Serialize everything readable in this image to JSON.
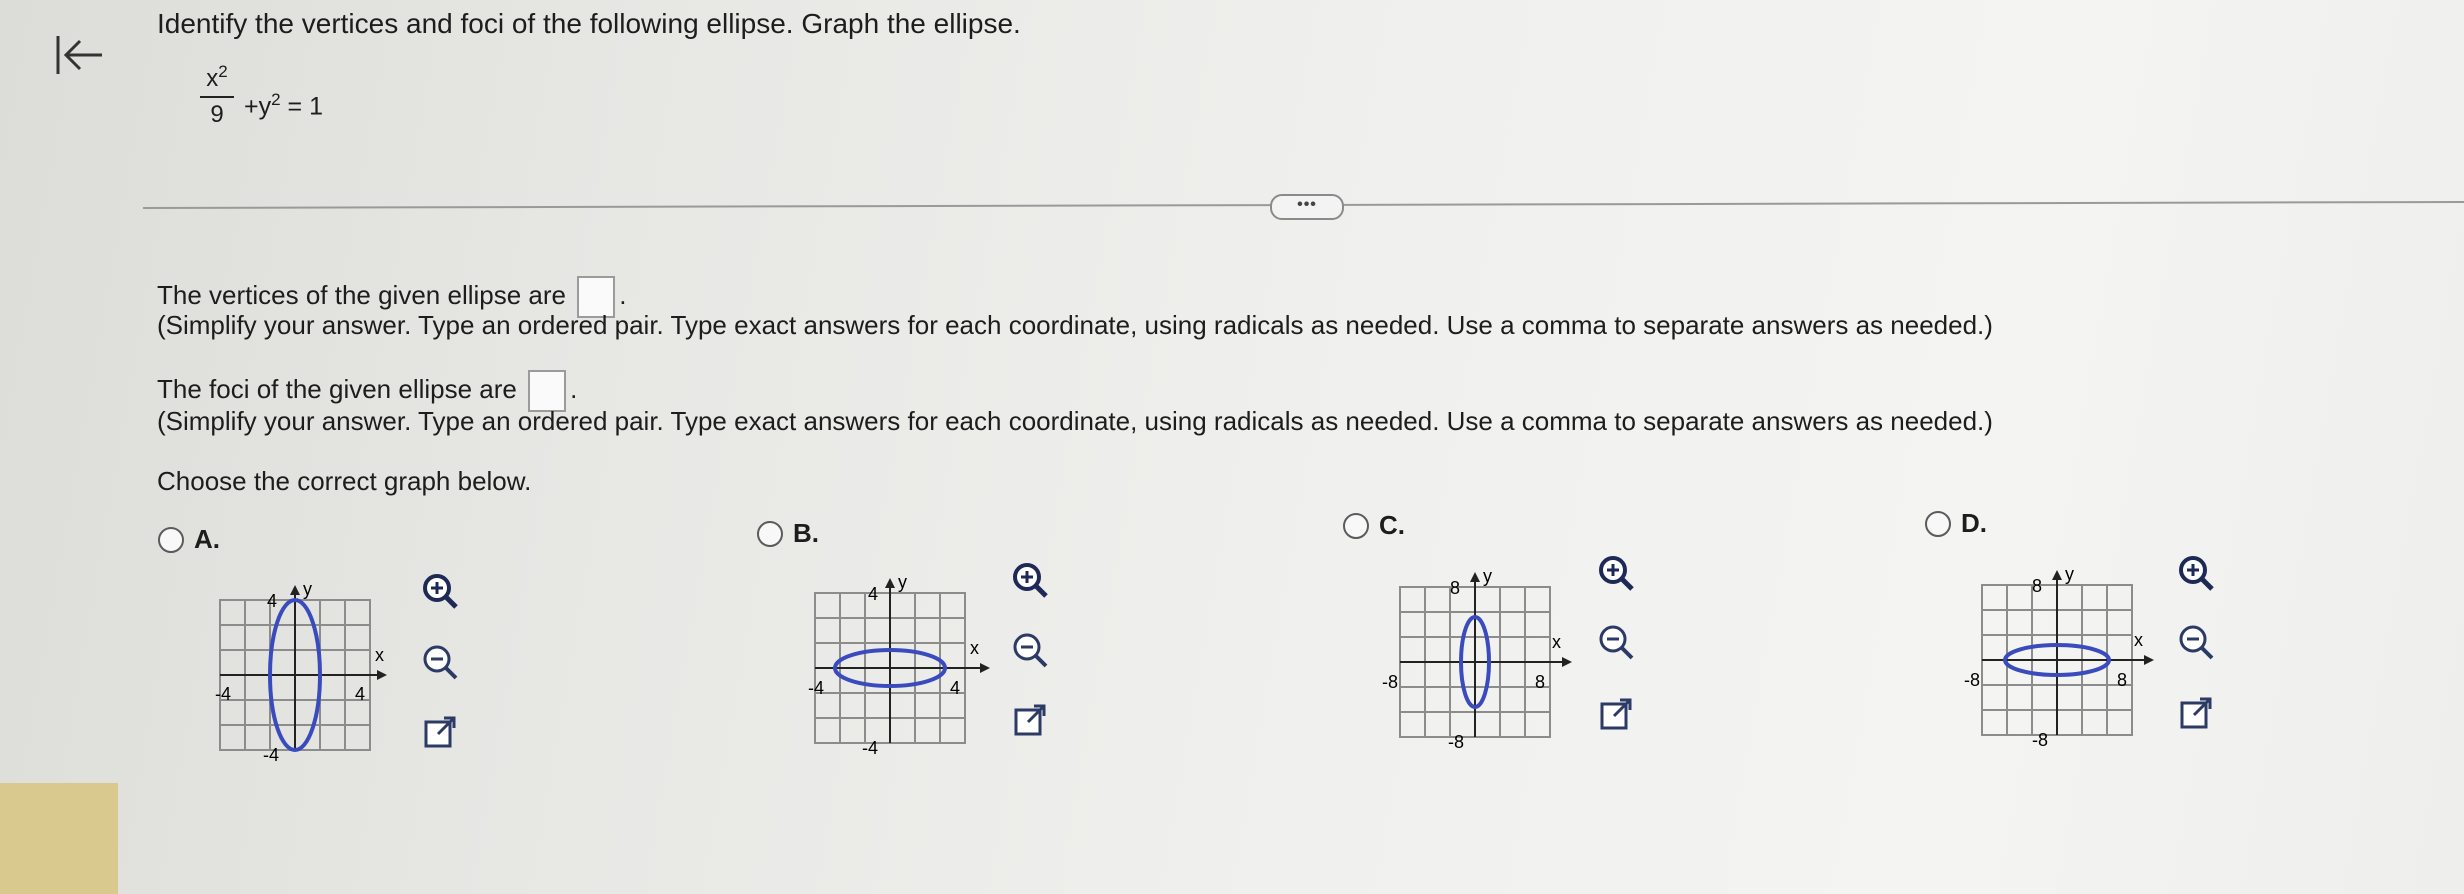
{
  "header": {
    "back_icon": "collapse-left-arrow-icon",
    "problem": "Identify the vertices and foci of the following ellipse. Graph the ellipse.",
    "equation": {
      "numerator": "x",
      "exponent": "2",
      "denominator": "9",
      "rest_prefix": "+y",
      "rest_exponent": "2",
      "rest_suffix": " = 1"
    }
  },
  "more_button": "•••",
  "questions": {
    "vertices_prefix": "The vertices of the given ellipse are",
    "vertices_input": "",
    "foci_prefix": "The foci of the given ellipse are",
    "foci_input": "",
    "instruction": "(Simplify your answer. Type an ordered pair. Type exact answers for each coordinate, using radicals as needed. Use a comma to separate answers as needed.)",
    "choose": "Choose the correct graph below.",
    "period": "."
  },
  "options": [
    {
      "letter": "A.",
      "scale": 4,
      "orientation": "vertical"
    },
    {
      "letter": "B.",
      "scale": 4,
      "orientation": "horizontal"
    },
    {
      "letter": "C.",
      "scale": 8,
      "orientation": "vertical"
    },
    {
      "letter": "D.",
      "scale": 8,
      "orientation": "horizontal"
    }
  ],
  "graph_labels": {
    "A": {
      "y_top": "4",
      "y_bottom": "-4",
      "x_left": "-4",
      "x_right": "4",
      "x_axis": "x",
      "y_axis": "y"
    },
    "B": {
      "y_top": "4",
      "y_bottom": "-4",
      "x_left": "-4",
      "x_right": "4",
      "x_axis": "x",
      "y_axis": "y"
    },
    "C": {
      "y_top": "8",
      "y_bottom": "-8",
      "x_left": "-8",
      "x_right": "8",
      "x_axis": "x",
      "y_axis": "y"
    },
    "D": {
      "y_top": "8",
      "y_bottom": "-8",
      "x_left": "-8",
      "x_right": "8",
      "x_axis": "x",
      "y_axis": "y"
    }
  },
  "icons": [
    "zoom-in-icon",
    "zoom-out-icon",
    "open-external-icon"
  ],
  "colors": {
    "ellipse": "#3a4bbd",
    "grid": "#8c8c8c",
    "text": "#1d1d1d"
  }
}
